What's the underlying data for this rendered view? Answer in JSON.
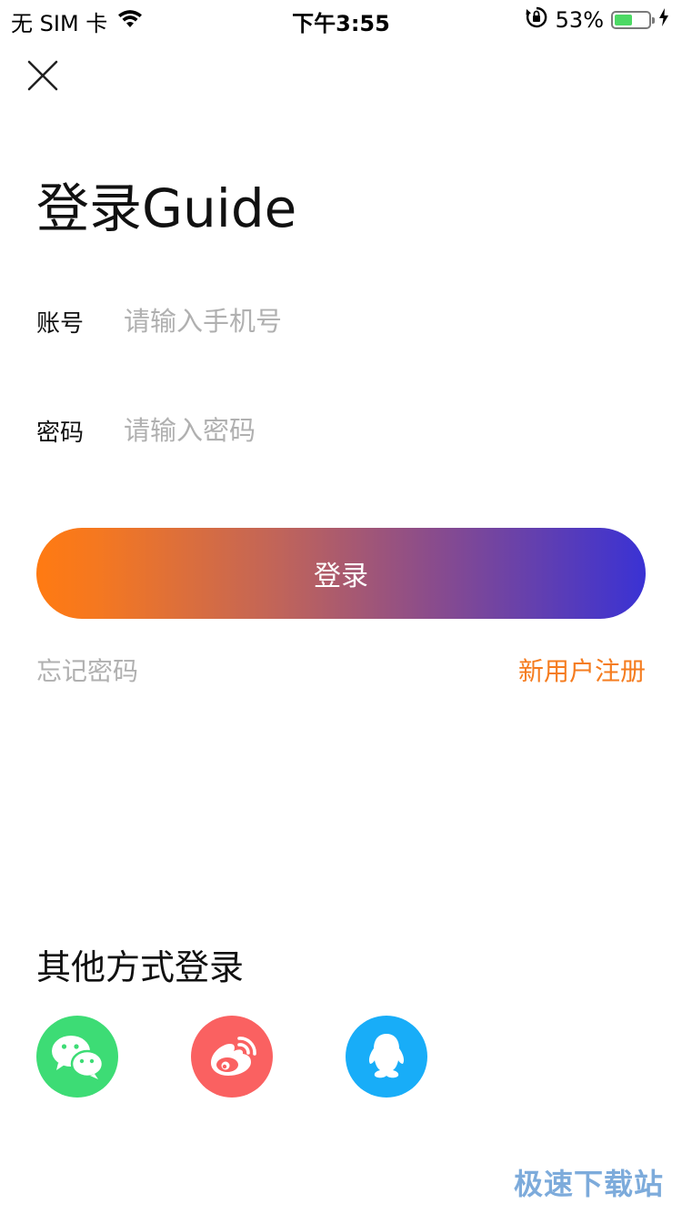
{
  "status_bar": {
    "carrier": "无 SIM 卡",
    "time": "下午3:55",
    "battery_percent_text": "53%",
    "battery_level": 0.53,
    "icons": [
      "wifi-icon",
      "orientation-lock-icon",
      "battery-icon",
      "charging-icon"
    ]
  },
  "header": {
    "close_icon": "close-icon",
    "title": "登录Guide"
  },
  "form": {
    "account_label": "账号",
    "account_placeholder": "请输入手机号",
    "password_label": "密码",
    "password_placeholder": "请输入密码",
    "login_button": "登录"
  },
  "links": {
    "forgot_password": "忘记密码",
    "register": "新用户注册"
  },
  "other_login": {
    "title": "其他方式登录",
    "providers": [
      {
        "name": "wechat-icon",
        "color": "#3ddc75"
      },
      {
        "name": "weibo-icon",
        "color": "#fa6161"
      },
      {
        "name": "qq-icon",
        "color": "#18adf8"
      }
    ]
  },
  "watermark": "极速下载站",
  "colors": {
    "accent_orange": "#f57c1f",
    "gradient_end": "#3a32d4",
    "placeholder_gray": "#b0b0b0"
  }
}
